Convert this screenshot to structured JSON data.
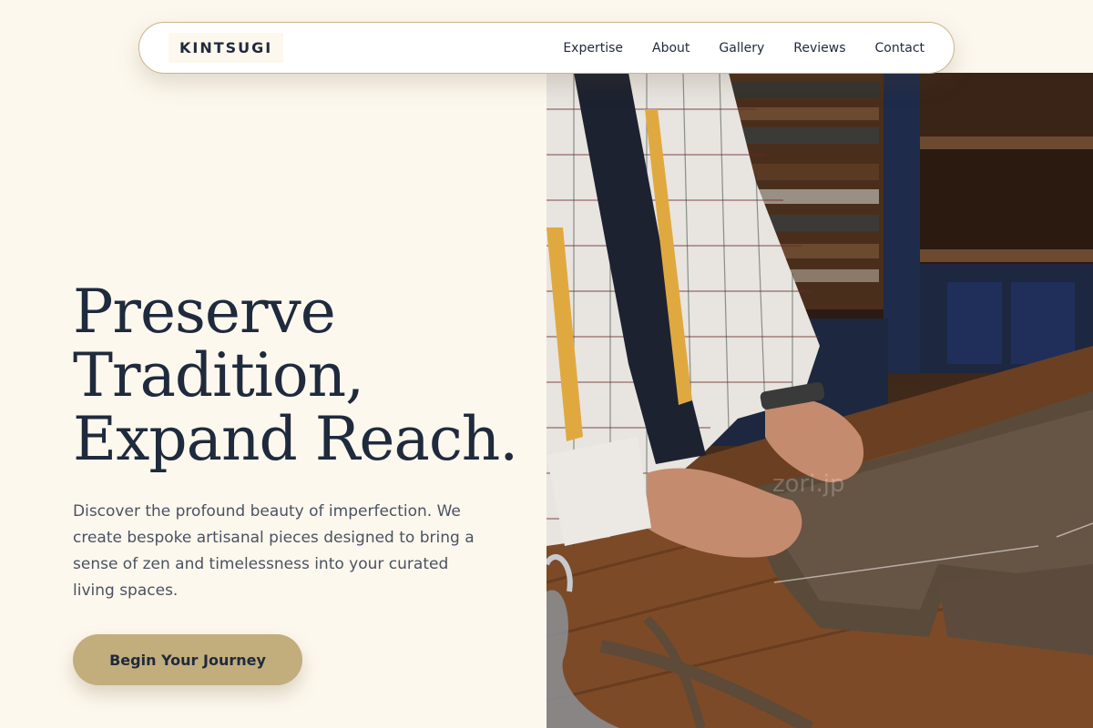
{
  "brand": {
    "logo": "KINTSUGI"
  },
  "nav": {
    "items": [
      {
        "label": "Expertise"
      },
      {
        "label": "About"
      },
      {
        "label": "Gallery"
      },
      {
        "label": "Reviews"
      },
      {
        "label": "Contact"
      }
    ]
  },
  "hero": {
    "headline_lines": [
      "Preserve",
      "Tradition,",
      "Expand Reach."
    ],
    "description": "Discover the profound beauty of imperfection. We create bespoke artisanal pieces designed to bring a sense of zen and timelessness into your curated living spaces.",
    "cta_label": "Begin Your Journey",
    "image_watermark": "zori.jp"
  },
  "colors": {
    "background": "#fdf8ee",
    "text": "#1f2a3c",
    "accent": "#c2ad7c",
    "border": "#c9b58a"
  }
}
